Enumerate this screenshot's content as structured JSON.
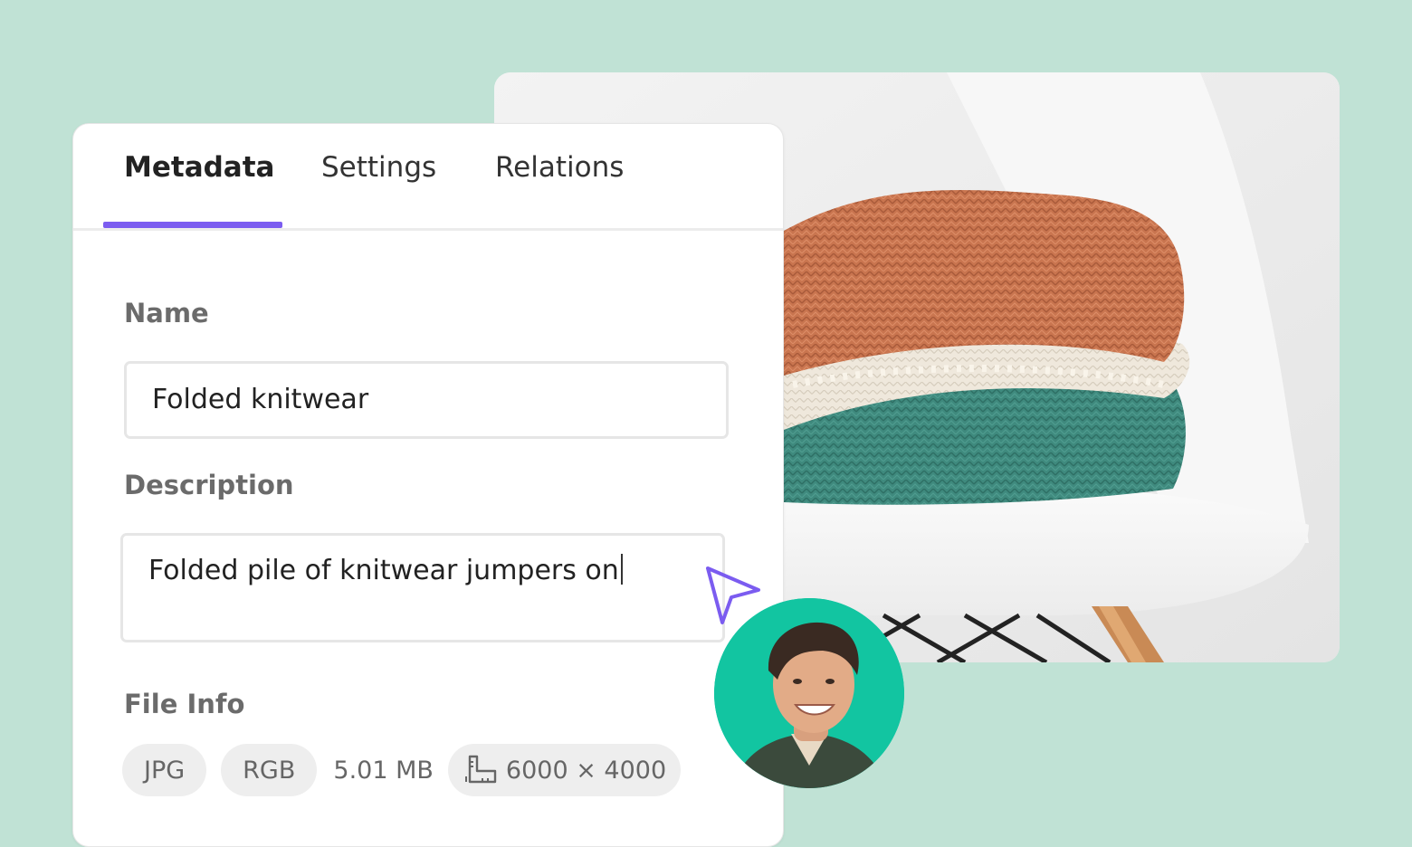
{
  "tabs": [
    {
      "label": "Metadata",
      "active": true
    },
    {
      "label": "Settings",
      "active": false
    },
    {
      "label": "Relations",
      "active": false
    }
  ],
  "fields": {
    "name": {
      "label": "Name",
      "value": "Folded knitwear"
    },
    "description": {
      "label": "Description",
      "value": "Folded pile of knitwear jumpers on"
    },
    "file_info": {
      "label": "File Info",
      "format": "JPG",
      "color_mode": "RGB",
      "size": "5.01 MB",
      "dimensions": "6000 × 4000"
    }
  },
  "icons": {
    "dimensions": "ruler-icon",
    "cursor": "pointer-cursor-icon"
  },
  "colors": {
    "background": "#c0e2d5",
    "accent": "#7b5cf0",
    "avatar_bg": "#12c5a1"
  }
}
